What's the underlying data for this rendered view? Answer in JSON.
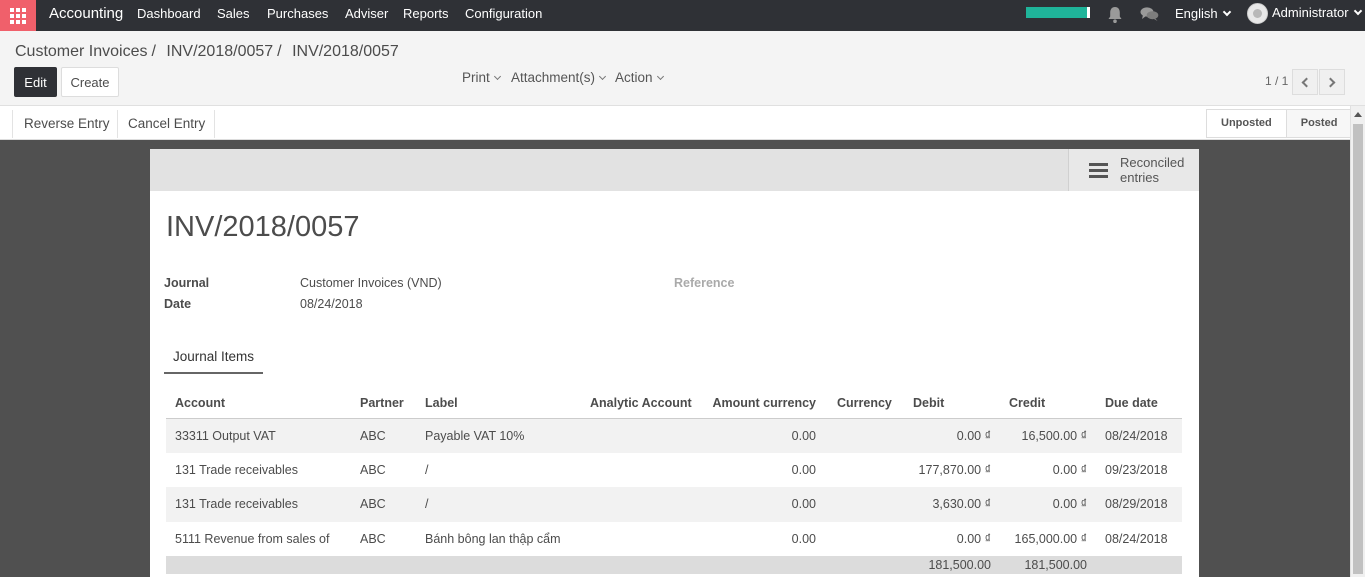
{
  "nav": {
    "app_name": "Accounting",
    "menus": [
      "Dashboard",
      "Sales",
      "Purchases",
      "Adviser",
      "Reports",
      "Configuration"
    ],
    "progress_fraction": 0.95,
    "progress_color": "#1fb49a",
    "apps_color": "#f0606b",
    "language": "English",
    "user": "Administrator"
  },
  "breadcrumb": [
    "Customer Invoices",
    "INV/2018/0057",
    "INV/2018/0057"
  ],
  "toolbar": {
    "edit_label": "Edit",
    "create_label": "Create",
    "print_label": "Print",
    "attachment_label": "Attachment(s)",
    "action_label": "Action",
    "pager": "1 / 1"
  },
  "statusbar": {
    "reverse_label": "Reverse Entry",
    "cancel_label": "Cancel Entry",
    "states": [
      "Unposted",
      "Posted"
    ],
    "active_state": "Posted"
  },
  "form": {
    "smart_button_line1": "Reconciled",
    "smart_button_line2": "entries",
    "title": "INV/2018/0057",
    "journal_label": "Journal",
    "journal_value": "Customer Invoices (VND)",
    "date_label": "Date",
    "date_value": "08/24/2018",
    "reference_label": "Reference",
    "reference_value": "",
    "tab_label": "Journal Items"
  },
  "items": {
    "columns": [
      "Account",
      "Partner",
      "Label",
      "Analytic Account",
      "Amount currency",
      "Currency",
      "Debit",
      "Credit",
      "Due date"
    ],
    "rows": [
      [
        "33311 Output VAT",
        "ABC",
        "Payable VAT 10%",
        "",
        "0.00",
        "",
        "0.00 ₫",
        "16,500.00 ₫",
        "08/24/2018"
      ],
      [
        "131 Trade receivables",
        "ABC",
        "/",
        "",
        "0.00",
        "",
        "177,870.00 ₫",
        "0.00 ₫",
        "09/23/2018"
      ],
      [
        "131 Trade receivables",
        "ABC",
        "/",
        "",
        "0.00",
        "",
        "3,630.00 ₫",
        "0.00 ₫",
        "08/29/2018"
      ],
      [
        "5111 Revenue from sales of",
        "ABC",
        "Bánh bông lan thập cẩm",
        "",
        "0.00",
        "",
        "0.00 ₫",
        "165,000.00 ₫",
        "08/24/2018"
      ]
    ],
    "total_debit": "181,500.00",
    "total_credit": "181,500.00"
  }
}
